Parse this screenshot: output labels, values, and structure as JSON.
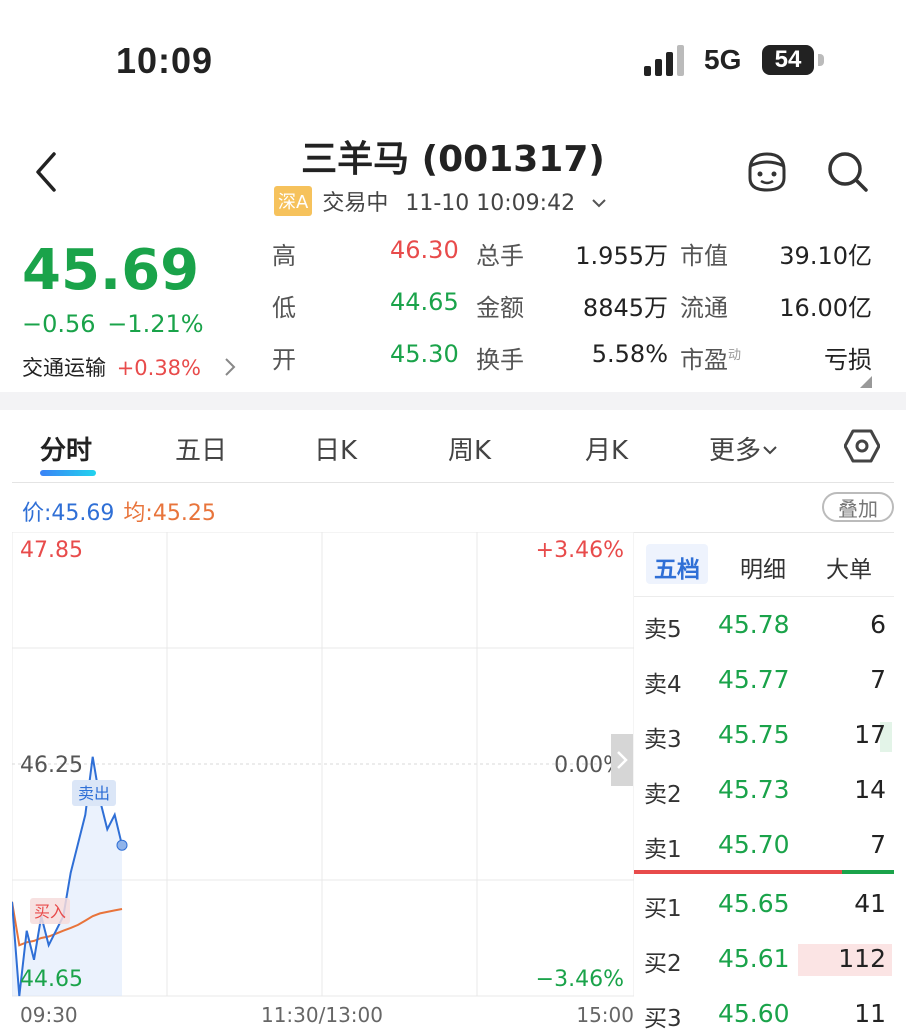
{
  "status_bar": {
    "time": "10:09",
    "network": "5G",
    "battery": "54"
  },
  "header": {
    "title": "三羊马 (001317)",
    "market_tag": "深A",
    "trade_status": "交易中",
    "datetime": "11-10 10:09:42"
  },
  "quote": {
    "price": "45.69",
    "change": "−0.56",
    "change_pct": "−1.21%",
    "sector_name": "交通运输",
    "sector_change": "+0.38%"
  },
  "stats": {
    "high_label": "高",
    "high_value": "46.30",
    "low_label": "低",
    "low_value": "44.65",
    "open_label": "开",
    "open_value": "45.30",
    "volume_label": "总手",
    "volume_value": "1.955万",
    "amount_label": "金额",
    "amount_value": "8845万",
    "turnover_label": "换手",
    "turnover_value": "5.58%",
    "mktcap_label": "市值",
    "mktcap_value": "39.10亿",
    "float_label": "流通",
    "float_value": "16.00亿",
    "pe_label": "市盈",
    "pe_sup": "动",
    "pe_value": "亏损"
  },
  "tabs": [
    "分时",
    "五日",
    "日K",
    "周K",
    "月K",
    "更多"
  ],
  "chart": {
    "price_label": "价:",
    "price_value": "45.69",
    "avg_label": "均:",
    "avg_value": "45.25",
    "overlay_button": "叠加",
    "y_top": "47.85",
    "y_mid": "46.25",
    "y_bottom": "44.65",
    "pct_top": "+3.46%",
    "pct_mid": "0.00%",
    "pct_bottom": "−3.46%",
    "x_start": "09:30",
    "x_mid": "11:30/13:00",
    "x_end": "15:00",
    "sell_marker": "卖出",
    "buy_marker": "买入"
  },
  "chart_data": {
    "type": "line",
    "x": [
      "09:30",
      "09:32",
      "09:35",
      "09:38",
      "09:41",
      "09:44",
      "09:47",
      "09:50",
      "09:53",
      "09:56",
      "09:59",
      "10:02",
      "10:04",
      "10:06",
      "10:08",
      "10:09"
    ],
    "series": [
      {
        "values": [
          45.3,
          44.65,
          45.1,
          44.9,
          45.2,
          45.0,
          45.1,
          45.2,
          45.5,
          45.7,
          45.9,
          46.3,
          46.0,
          45.8,
          45.9,
          45.69
        ]
      },
      {
        "values": [
          45.3,
          45.0,
          45.02,
          45.03,
          45.05,
          45.06,
          45.08,
          45.1,
          45.12,
          45.14,
          45.17,
          45.2,
          45.22,
          45.23,
          45.24,
          45.25
        ]
      }
    ],
    "ylim": [
      44.65,
      47.85
    ]
  },
  "orderbook": {
    "tabs": [
      "五档",
      "明细",
      "大单"
    ],
    "asks": [
      {
        "label": "卖5",
        "price": "45.78",
        "vol": "6"
      },
      {
        "label": "卖4",
        "price": "45.77",
        "vol": "7"
      },
      {
        "label": "卖3",
        "price": "45.75",
        "vol": "17"
      },
      {
        "label": "卖2",
        "price": "45.73",
        "vol": "14"
      },
      {
        "label": "卖1",
        "price": "45.70",
        "vol": "7"
      }
    ],
    "bids": [
      {
        "label": "买1",
        "price": "45.65",
        "vol": "41"
      },
      {
        "label": "买2",
        "price": "45.61",
        "vol": "112"
      },
      {
        "label": "买3",
        "price": "45.60",
        "vol": "11"
      }
    ]
  },
  "colors": {
    "up": "#e84b4b",
    "down": "#1aa34a",
    "price_line": "#2f6fd6",
    "avg_line": "#e8743b"
  },
  "icons": [
    "back-arrow-icon",
    "face-icon",
    "search-icon",
    "chevron-down-icon",
    "chevron-right-icon",
    "settings-hex-icon"
  ]
}
